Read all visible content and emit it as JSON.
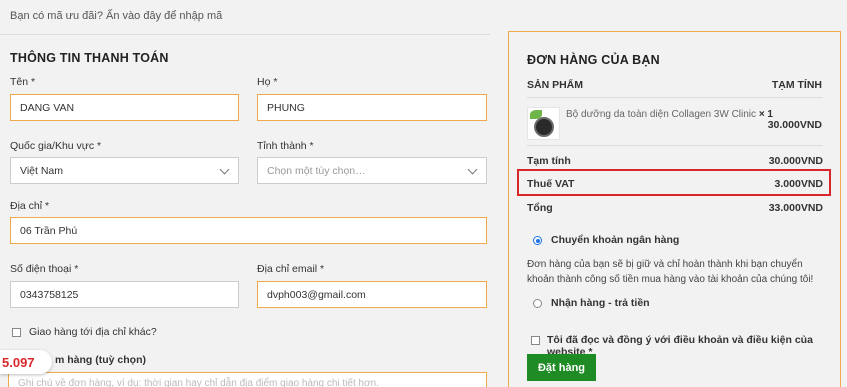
{
  "coupon": {
    "text": "Bạn có mã ưu đãi? Ấn vào đây để nhập mã"
  },
  "billing": {
    "title": "THÔNG TIN THANH TOÁN",
    "first_name": {
      "label": "Tên",
      "value": "DANG VAN"
    },
    "last_name": {
      "label": "Họ",
      "value": "PHUNG"
    },
    "country": {
      "label": "Quốc gia/Khu vực",
      "value": "Việt Nam"
    },
    "province": {
      "label": "Tỉnh thành",
      "placeholder": "Chọn một tùy chọn…"
    },
    "address": {
      "label": "Địa chỉ",
      "value": "06 Trần Phú"
    },
    "phone": {
      "label": "Số điện thoại",
      "value": "0343758125"
    },
    "email": {
      "label": "Địa chỉ email",
      "value": "dvph003@gmail.com"
    },
    "required_mark": "*",
    "ship_other": "Giao hàng tới địa chỉ khác?",
    "note_label": "m hàng (tuỳ chọn)",
    "note_placeholder": "Ghi chú về đơn hàng, ví dụ: thời gian hay chỉ dẫn địa điểm giao hàng chi tiết hơn."
  },
  "badge": {
    "text": "5.097",
    "color": "#d9262a"
  },
  "order": {
    "title": "ĐƠN HÀNG CỦA BẠN",
    "col_product": "SẢN PHẨM",
    "col_subtotal": "TẠM TÍNH",
    "item": {
      "name": "Bộ dưỡng da toàn diện Collagen 3W Clinic",
      "qty": "× 1",
      "price": "30.000VND"
    },
    "subtotal": {
      "label": "Tạm tính",
      "value": "30.000VND"
    },
    "vat": {
      "label": "Thuế VAT",
      "value": "3.000VND"
    },
    "total": {
      "label": "Tổng",
      "value": "33.000VND"
    },
    "payment_bank": "Chuyển khoản ngân hàng",
    "payment_bank_desc": "Đơn hàng của bạn sẽ bị giữ và chỉ hoàn thành khi bạn chuyển khoản thành công số tiền mua hàng vào tài khoản của chúng tôi!",
    "payment_cod": "Nhận hàng - trả tiền",
    "terms": "Tôi đã đọc và đồng ý với điều khoản và điều kiện của website *",
    "place_order": "Đặt hàng"
  },
  "colors": {
    "accent": "#f0a84b",
    "button": "#1f8b24",
    "highlight": "#d9262a",
    "radio": "#1a73e8"
  }
}
